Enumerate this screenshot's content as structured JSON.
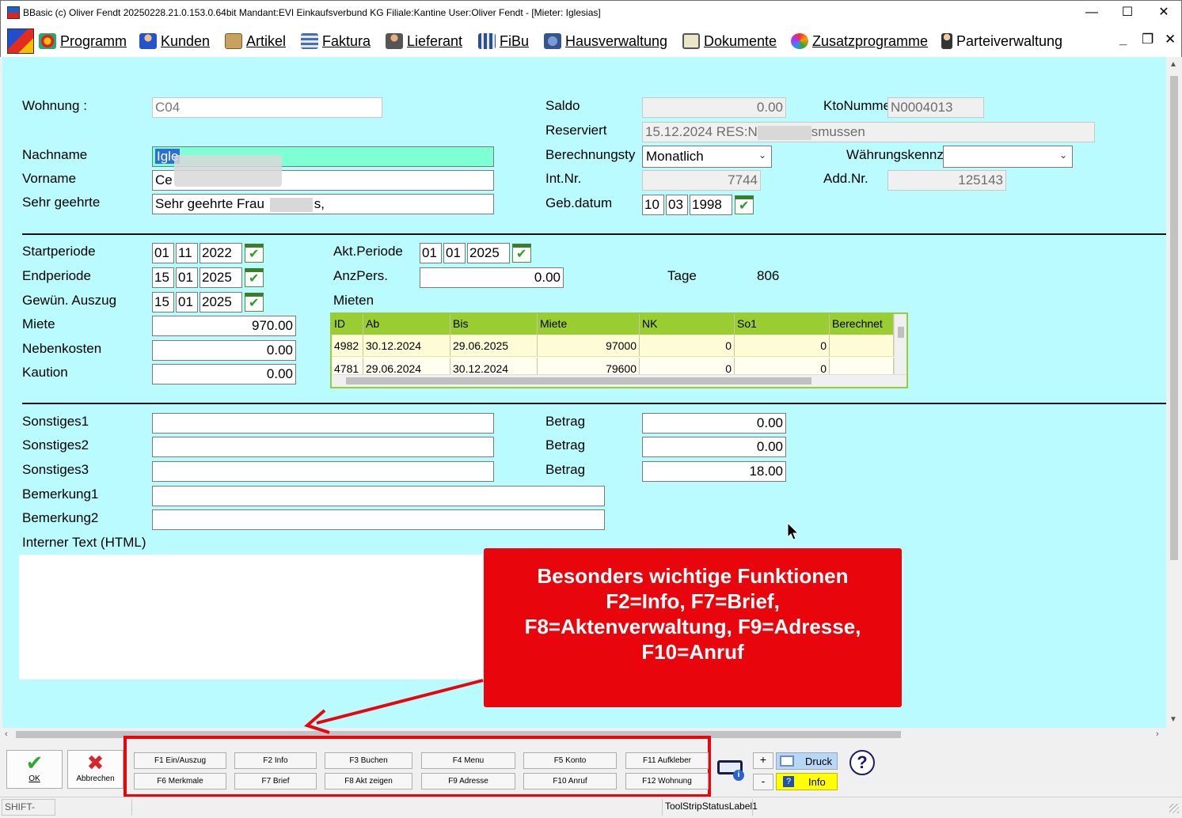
{
  "window": {
    "title": "BBasic (c) Oliver Fendt 20250228.21.0.153.0.64bit Mandant:EVI Einkaufsverbund KG Filiale:Kantine User:Oliver Fendt - [Mieter: Iglesias]",
    "minimize": "—",
    "maximize": "☐",
    "close": "✕"
  },
  "menu": {
    "items": [
      {
        "label": "Programm",
        "icon": "program-icon"
      },
      {
        "label": "Kunden",
        "icon": "customers-icon"
      },
      {
        "label": "Artikel",
        "icon": "articles-icon"
      },
      {
        "label": "Faktura",
        "icon": "invoice-icon"
      },
      {
        "label": "Lieferant",
        "icon": "supplier-icon"
      },
      {
        "label": "FiBu",
        "icon": "accounting-icon"
      },
      {
        "label": "Hausverwaltung",
        "icon": "property-icon"
      },
      {
        "label": "Dokumente",
        "icon": "documents-icon"
      },
      {
        "label": "Zusatzprogramme",
        "icon": "addons-icon"
      },
      {
        "label": "Parteiverwaltung",
        "icon": "party-icon"
      }
    ],
    "mdi_minimize": "_",
    "mdi_restore": "❐",
    "mdi_close": "✕"
  },
  "form": {
    "wohnung_label": "Wohnung :",
    "wohnung": "C04",
    "nachname_label": "Nachname",
    "nachname": "Igle",
    "vorname_label": "Vorname",
    "vorname": "Ce",
    "anrede_label": "Sehr geehrte",
    "anrede_pre": "Sehr geehrte Frau",
    "anrede_post": "s,",
    "saldo_label": "Saldo",
    "saldo": "0.00",
    "kto_label": "KtoNumme",
    "kto": "N0004013",
    "reserviert_label": "Reserviert",
    "reserviert_pre": "15.12.2024 RES:N",
    "reserviert_post": "smussen",
    "berechnung_label": "Berechnungsty",
    "berechnung": "Monatlich",
    "waehrung_label": "Währungskennz.:",
    "waehrung": "",
    "intnr_label": "Int.Nr.",
    "intnr": "7744",
    "addnr_label": "Add.Nr.",
    "addnr": "125143",
    "geb_label": "Geb.datum",
    "geb": [
      "10",
      "03",
      "1998"
    ],
    "start_label": "Startperiode",
    "start": [
      "01",
      "11",
      "2022"
    ],
    "end_label": "Endperiode",
    "end": [
      "15",
      "01",
      "2025"
    ],
    "auszug_label": "Gewün. Auszug",
    "auszug": [
      "15",
      "01",
      "2025"
    ],
    "akt_label": "Akt.Periode",
    "akt": [
      "01",
      "01",
      "2025"
    ],
    "anzpers_label": "AnzPers.",
    "anzpers": "0.00",
    "tage_label": "Tage",
    "tage": "806",
    "miete_label": "Miete",
    "miete": "970.00",
    "nk_label": "Nebenkosten",
    "nk": "0.00",
    "kaution_label": "Kaution",
    "kaution": "0.00",
    "mieten_label": "Mieten",
    "sonst1_label": "Sonstiges1",
    "sonst2_label": "Sonstiges2",
    "sonst3_label": "Sonstiges3",
    "sonst1": "",
    "sonst2": "",
    "sonst3": "",
    "betrag_label": "Betrag",
    "betrag1": "0.00",
    "betrag2": "0.00",
    "betrag3": "18.00",
    "bem1_label": "Bemerkung1",
    "bem2_label": "Bemerkung2",
    "bem1": "",
    "bem2": "",
    "intern_label": "Interner Text (HTML)"
  },
  "mieten_grid": {
    "columns": [
      "ID",
      "Ab",
      "Bis",
      "Miete",
      "NK",
      "So1",
      "Berechnet"
    ],
    "rows": [
      [
        "4982",
        "30.12.2024",
        "29.06.2025",
        "97000",
        "0",
        "0",
        ""
      ],
      [
        "4781",
        "29.06.2024",
        "30.12.2024",
        "79600",
        "0",
        "0",
        ""
      ]
    ]
  },
  "callout": {
    "lines": [
      "Besonders wichtige Funktionen",
      "F2=Info, F7=Brief,",
      "F8=Aktenverwaltung, F9=Adresse,",
      "F10=Anruf"
    ],
    "color": "#e8050b"
  },
  "toolbar": {
    "ok": "OK",
    "cancel": "Abbrechen",
    "fkeys_top": [
      "F1 Ein/Auszug",
      "F2 Info",
      "F3 Buchen",
      "F4 Menu",
      "F5 Konto",
      "F11 Aufkleber"
    ],
    "fkeys_bottom": [
      "F6 Merkmale",
      "F7 Brief",
      "F8 Akt zeigen",
      "F9 Adresse",
      "F10 Anruf",
      "F12 Wohnung"
    ],
    "plus": "+",
    "minus": "-",
    "druck": "Druck",
    "info": "Info",
    "help": "?"
  },
  "status": {
    "shift": "SHIFT-Taste",
    "label1": "ToolStripStatusLabel1"
  }
}
